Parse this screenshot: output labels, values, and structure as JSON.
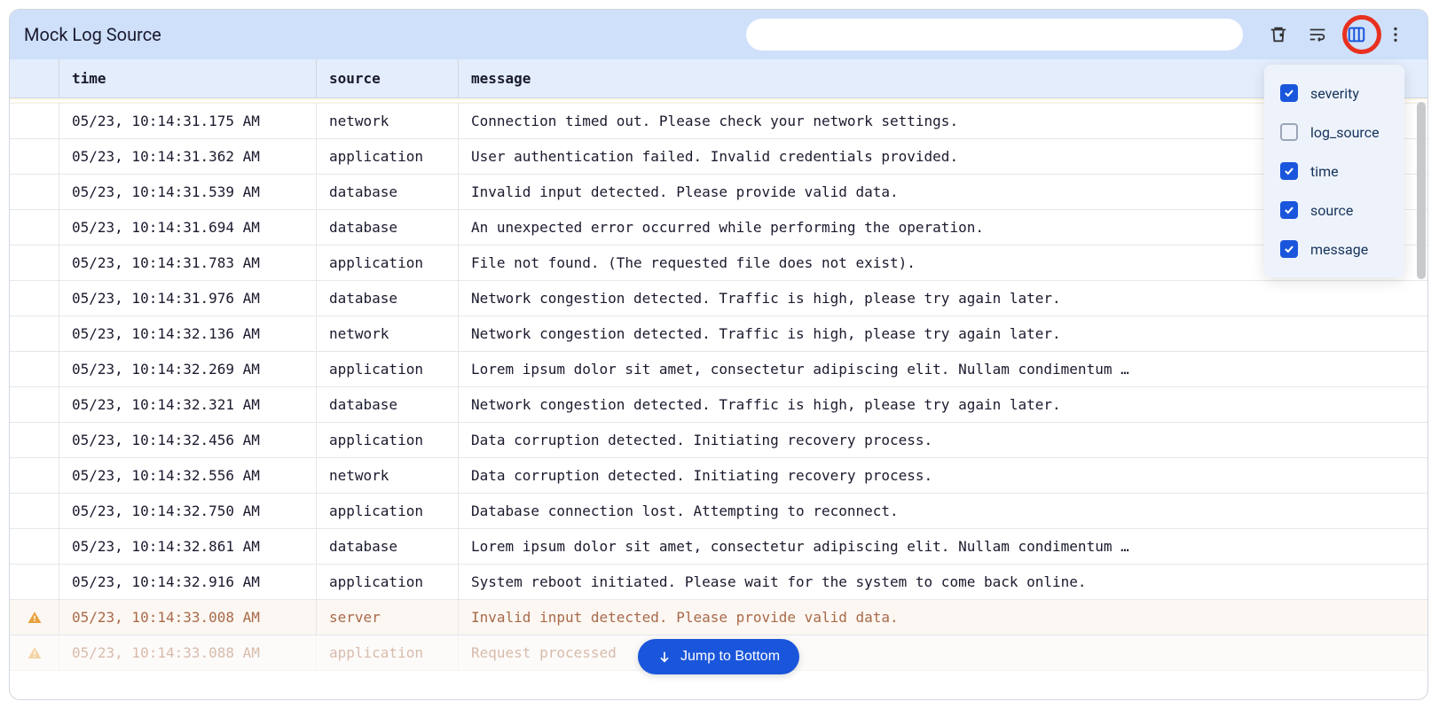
{
  "header": {
    "title": "Mock Log Source",
    "search_value": ""
  },
  "columns": {
    "time": "time",
    "source": "source",
    "message": "message"
  },
  "rows": [
    {
      "severity": "",
      "time": "05/23, 10:14:31.175 AM",
      "source": "network",
      "message": "Connection timed out. Please check your network settings."
    },
    {
      "severity": "",
      "time": "05/23, 10:14:31.362 AM",
      "source": "application",
      "message": "User authentication failed. Invalid credentials provided."
    },
    {
      "severity": "",
      "time": "05/23, 10:14:31.539 AM",
      "source": "database",
      "message": "Invalid input detected. Please provide valid data."
    },
    {
      "severity": "",
      "time": "05/23, 10:14:31.694 AM",
      "source": "database",
      "message": "An unexpected error occurred while performing the operation."
    },
    {
      "severity": "",
      "time": "05/23, 10:14:31.783 AM",
      "source": "application",
      "message": "File not found. (The requested file does not exist)."
    },
    {
      "severity": "",
      "time": "05/23, 10:14:31.976 AM",
      "source": "database",
      "message": "Network congestion detected. Traffic is high, please try again later."
    },
    {
      "severity": "",
      "time": "05/23, 10:14:32.136 AM",
      "source": "network",
      "message": "Network congestion detected. Traffic is high, please try again later."
    },
    {
      "severity": "",
      "time": "05/23, 10:14:32.269 AM",
      "source": "application",
      "message": "Lorem ipsum dolor sit amet, consectetur adipiscing elit. Nullam condimentum …"
    },
    {
      "severity": "",
      "time": "05/23, 10:14:32.321 AM",
      "source": "database",
      "message": "Network congestion detected. Traffic is high, please try again later."
    },
    {
      "severity": "",
      "time": "05/23, 10:14:32.456 AM",
      "source": "application",
      "message": "Data corruption detected. Initiating recovery process."
    },
    {
      "severity": "",
      "time": "05/23, 10:14:32.556 AM",
      "source": "network",
      "message": "Data corruption detected. Initiating recovery process."
    },
    {
      "severity": "",
      "time": "05/23, 10:14:32.750 AM",
      "source": "application",
      "message": "Database connection lost. Attempting to reconnect."
    },
    {
      "severity": "",
      "time": "05/23, 10:14:32.861 AM",
      "source": "database",
      "message": "Lorem ipsum dolor sit amet, consectetur adipiscing elit. Nullam condimentum …"
    },
    {
      "severity": "",
      "time": "05/23, 10:14:32.916 AM",
      "source": "application",
      "message": "System reboot initiated. Please wait for the system to come back online."
    },
    {
      "severity": "warn",
      "time": "05/23, 10:14:33.008 AM",
      "source": "server",
      "message": "Invalid input detected. Please provide valid data."
    },
    {
      "severity": "warn",
      "faded": true,
      "time": "05/23, 10:14:33.088 AM",
      "source": "application",
      "message": "Request processed"
    }
  ],
  "column_picker": [
    {
      "label": "severity",
      "checked": true
    },
    {
      "label": "log_source",
      "checked": false
    },
    {
      "label": "time",
      "checked": true
    },
    {
      "label": "source",
      "checked": true
    },
    {
      "label": "message",
      "checked": true
    }
  ],
  "jump_button_label": "Jump to Bottom"
}
